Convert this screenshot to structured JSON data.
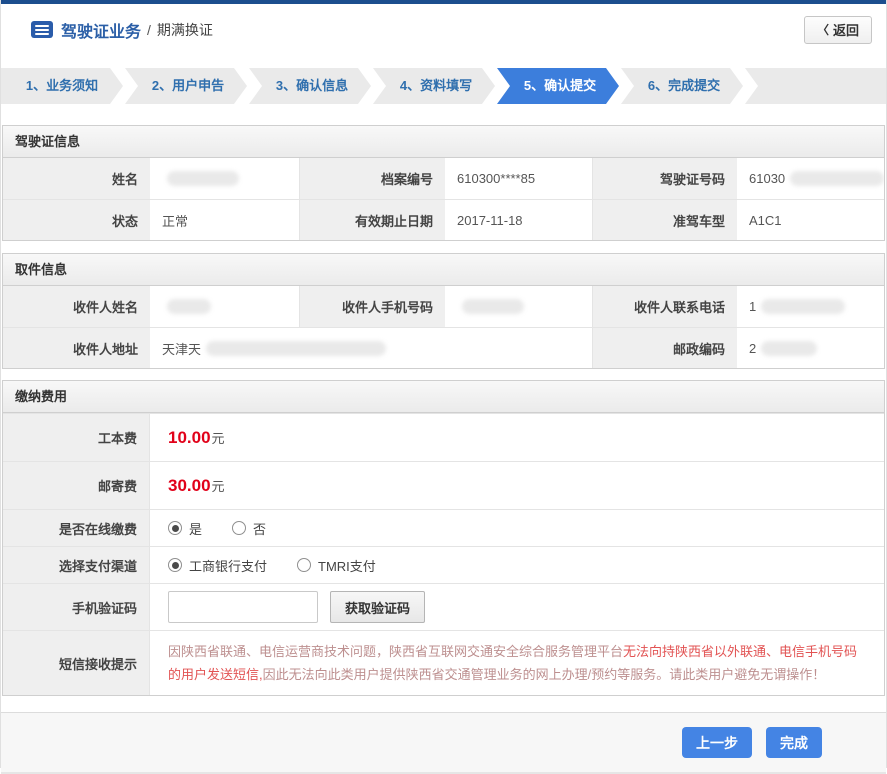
{
  "page": {
    "breadcrumb_primary": "驾驶证业务",
    "breadcrumb_separator": "/",
    "breadcrumb_secondary": "期满换证",
    "back_chevron": "〈",
    "back_label": "返回"
  },
  "wizard": {
    "active_step_index": 4,
    "active_color": "#3c7edc",
    "steps": [
      {
        "label": "1、业务须知"
      },
      {
        "label": "2、用户申告"
      },
      {
        "label": "3、确认信息"
      },
      {
        "label": "4、资料填写"
      },
      {
        "label": "5、确认提交"
      },
      {
        "label": "6、完成提交"
      }
    ]
  },
  "license_section": {
    "title": "驾驶证信息",
    "row1": {
      "name_label": "姓名",
      "name_value": "",
      "file_label": "档案编号",
      "file_value": "610300****85",
      "license_no_label": "驾驶证号码",
      "license_no_value": "61030"
    },
    "row2": {
      "status_label": "状态",
      "status_value": "正常",
      "expiry_label": "有效期止日期",
      "expiry_value": "2017-11-18",
      "vehicle_label": "准驾车型",
      "vehicle_value": "A1C1"
    }
  },
  "pickup_section": {
    "title": "取件信息",
    "row1": {
      "recipient_name_label": "收件人姓名",
      "recipient_name_value": "",
      "mobile_label": "收件人手机号码",
      "mobile_value": "",
      "phone_label": "收件人联系电话",
      "phone_value": "1"
    },
    "row2": {
      "address_label": "收件人地址",
      "address_value": "天津天",
      "postal_label": "邮政编码",
      "postal_value": "2"
    }
  },
  "fees_section": {
    "title": "缴纳费用",
    "production_fee": {
      "label": "工本费",
      "amount": "10.00",
      "unit": "元"
    },
    "mailing_fee": {
      "label": "邮寄费",
      "amount": "30.00",
      "unit": "元"
    },
    "online_payment": {
      "label": "是否在线缴费",
      "options": [
        {
          "label": "是",
          "selected": true
        },
        {
          "label": "否",
          "selected": false
        }
      ]
    },
    "payment_channel": {
      "label": "选择支付渠道",
      "options": [
        {
          "label": "工商银行支付",
          "selected": true
        },
        {
          "label": "TMRI支付",
          "selected": false
        }
      ]
    },
    "verification": {
      "label": "手机验证码",
      "input_value": "",
      "button_label": "获取验证码"
    },
    "sms_notice": {
      "label": "短信接收提示",
      "part1": "因陕西省联通、电信运营商技术问题，陕西省互联网交通安全综合服务管理平台",
      "part2": "无法向持陕西省以外联通、电信手机号码的用户发送短信,",
      "part3": "因此无法向此类用户提供陕西省交通管理业务的网上办理/预约等服务。请此类用户避免无谓操作！"
    }
  },
  "footer": {
    "prev_label": "上一步",
    "finish_label": "完成"
  },
  "colors": {
    "topbar": "#1c4e8e",
    "active_step": "#3c7edc",
    "fee_red": "#e1021a",
    "button_blue": "#4484e4"
  }
}
